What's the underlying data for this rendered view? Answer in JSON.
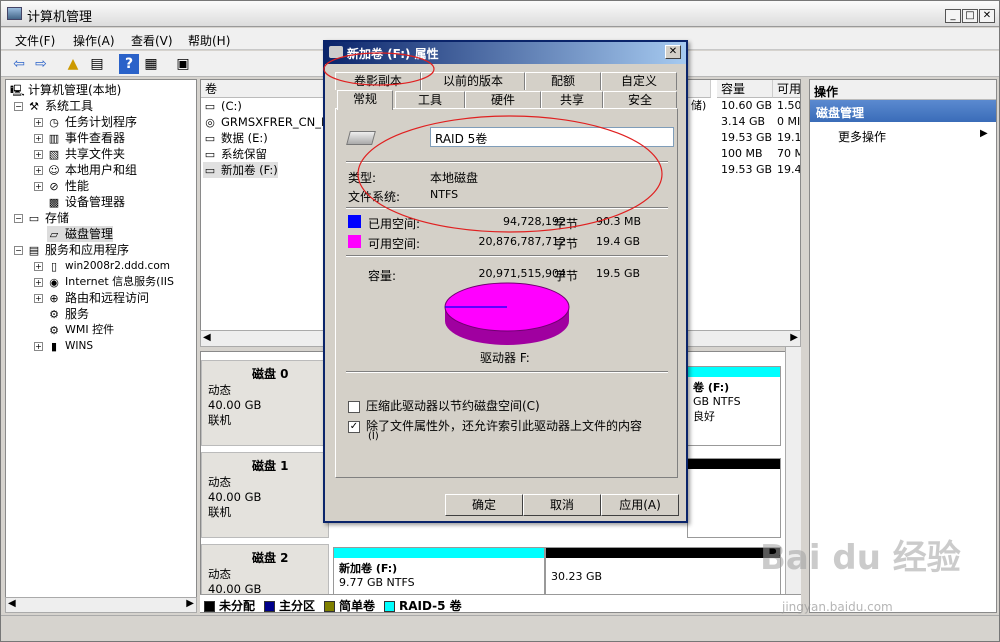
{
  "window": {
    "title": "计算机管理"
  },
  "menu": [
    "文件(F)",
    "操作(A)",
    "查看(V)",
    "帮助(H)"
  ],
  "tree": {
    "root": "计算机管理(本地)",
    "system_tools": "系统工具",
    "task_scheduler": "任务计划程序",
    "event_viewer": "事件查看器",
    "shared_folders": "共享文件夹",
    "local_users": "本地用户和组",
    "performance": "性能",
    "device_manager": "设备管理器",
    "storage": "存储",
    "disk_management": "磁盘管理",
    "services_apps": "服务和应用程序",
    "win2008": "win2008r2.ddd.com",
    "iis": "Internet 信息服务(IIS",
    "routing": "路由和远程访问",
    "services": "服务",
    "wmi": "WMI 控件",
    "wins": "WINS"
  },
  "volumes": {
    "col_vol": "卷",
    "col_cap": "容量",
    "col_free": "可用",
    "rows": [
      {
        "name": "(C:)",
        "status": "储)",
        "cap": "10.60 GB",
        "free": "1.50"
      },
      {
        "name": "GRMSXFRER_CN_DVD",
        "status": "",
        "cap": "3.14 GB",
        "free": "0 MI"
      },
      {
        "name": "数据 (E:)",
        "status": "",
        "cap": "19.53 GB",
        "free": "19.1"
      },
      {
        "name": "系统保留",
        "status": "",
        "cap": "100 MB",
        "free": "70 M"
      },
      {
        "name": "新加卷 (F:)",
        "status": "",
        "cap": "19.53 GB",
        "free": "19.4"
      }
    ]
  },
  "disks": [
    {
      "title": "磁盘 0",
      "type": "动态",
      "size": "40.00 GB",
      "state": "联机"
    },
    {
      "title": "磁盘 1",
      "type": "动态",
      "size": "40.00 GB",
      "state": "联机"
    },
    {
      "title": "磁盘 2",
      "type": "动态",
      "size": "40.00 GB",
      "state": "联机"
    }
  ],
  "disk0_part": {
    "name": "卷 (F:)",
    "fs": "GB NTFS",
    "status": "良好"
  },
  "disk2_parts": [
    {
      "name": "新加卷  (F:)",
      "size": "9.77 GB NTFS"
    },
    {
      "name": "",
      "size": "30.23 GB"
    }
  ],
  "legend": [
    "未分配",
    "主分区",
    "简单卷",
    "RAID-5 卷"
  ],
  "actions": {
    "header": "操作",
    "section": "磁盘管理",
    "more": "更多操作"
  },
  "dialog": {
    "title": "新加卷  (F:) 属性",
    "tabs_row1": [
      "卷影副本",
      "以前的版本",
      "配额",
      "自定义"
    ],
    "tabs_row2": [
      "常规",
      "工具",
      "硬件",
      "共享",
      "安全"
    ],
    "volume_name": "RAID 5卷",
    "type_label": "类型:",
    "type_value": "本地磁盘",
    "fs_label": "文件系统:",
    "fs_value": "NTFS",
    "used_label": "已用空间:",
    "used_bytes": "94,728,192",
    "used_unit": "字节",
    "used_size": "90.3 MB",
    "free_label": "可用空间:",
    "free_bytes": "20,876,787,712",
    "free_unit": "字节",
    "free_size": "19.4 GB",
    "cap_label": "容量:",
    "cap_bytes": "20,971,515,904",
    "cap_unit": "字节",
    "cap_size": "19.5 GB",
    "drive_label": "驱动器 F:",
    "compress": "压缩此驱动器以节约磁盘空间(C)",
    "index_line1": "除了文件属性外，还允许索引此驱动器上文件的内容",
    "index_line2": "(I)",
    "ok": "确定",
    "cancel": "取消",
    "apply": "应用(A)",
    "used_color": "#0000ff",
    "free_color": "#ff00ff"
  },
  "watermark": {
    "brand": "Bai du 经验",
    "url": "jingyan.baidu.com"
  }
}
